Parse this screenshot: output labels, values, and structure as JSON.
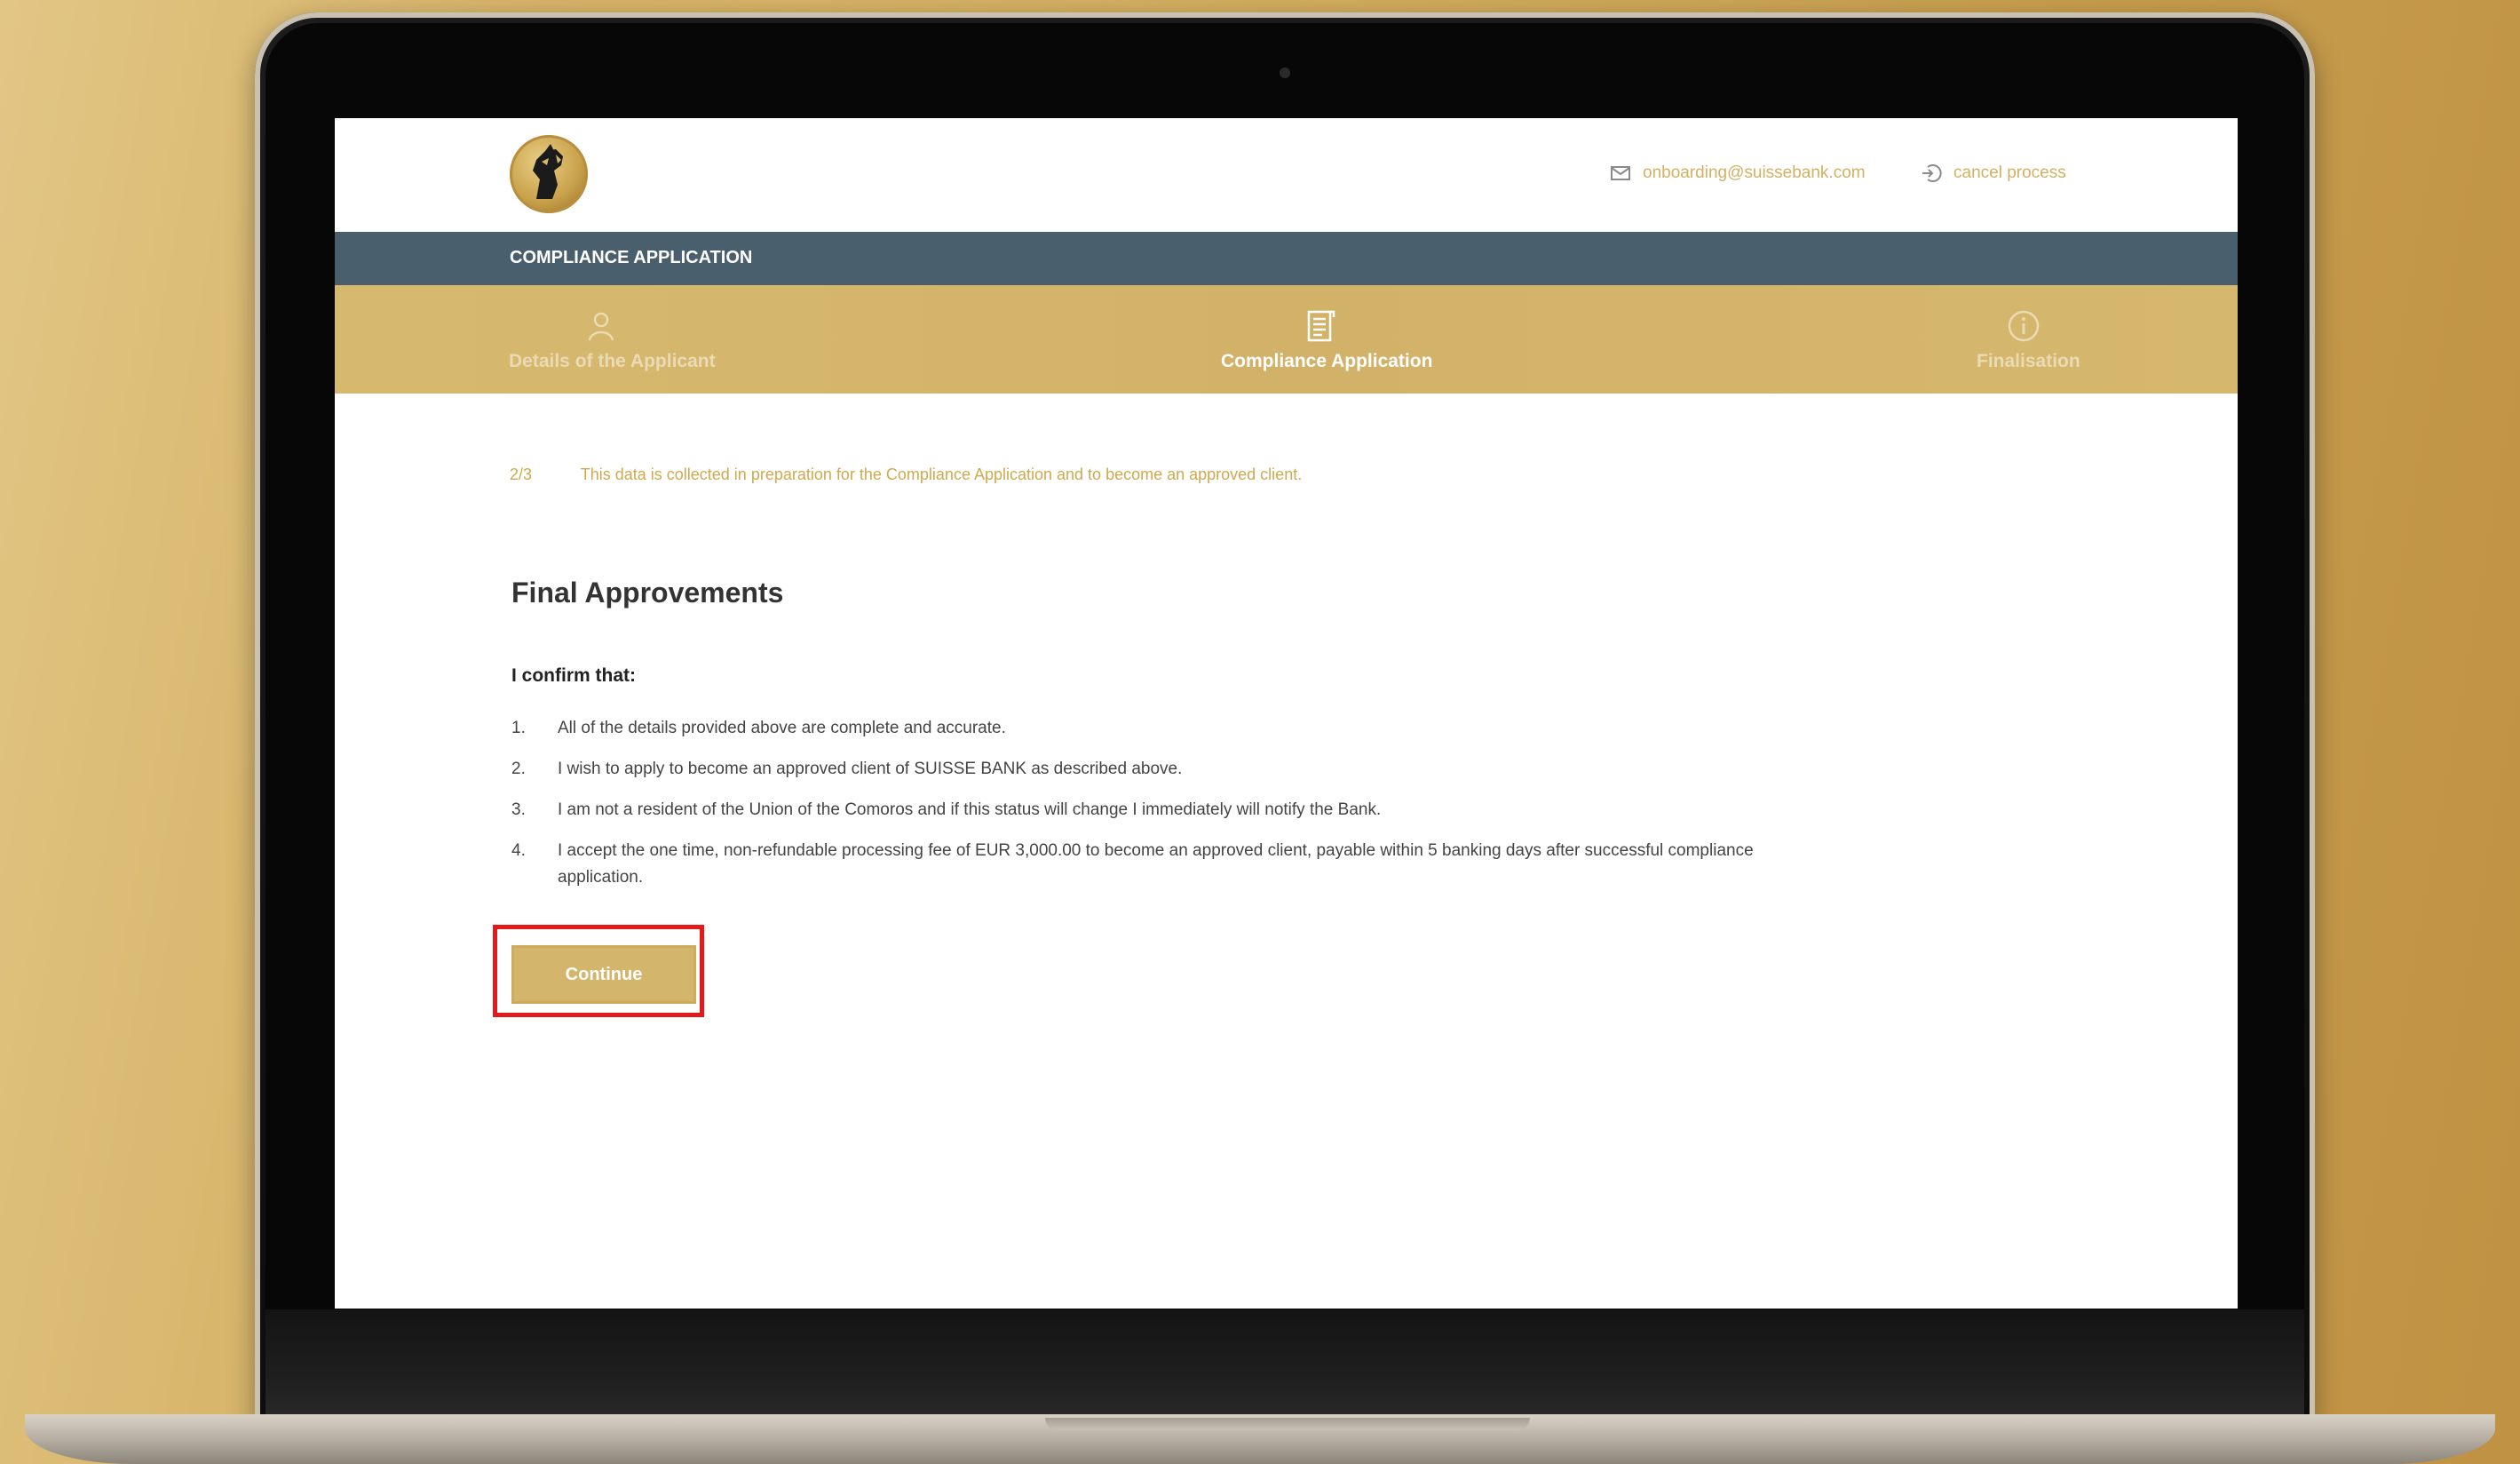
{
  "header": {
    "logo": "horse-head-logo",
    "email": "onboarding@suissebank.com",
    "email_icon": "mail-icon",
    "cancel_label": "cancel process",
    "cancel_icon": "logout-icon"
  },
  "title_bar": {
    "label": "COMPLIANCE APPLICATION"
  },
  "steps": [
    {
      "label": "Details of the Applicant",
      "icon": "user-icon",
      "active": false
    },
    {
      "label": "Compliance Application",
      "icon": "document-icon",
      "active": true
    },
    {
      "label": "Finalisation",
      "icon": "info-icon",
      "active": false
    }
  ],
  "info": {
    "step": "2/3",
    "text": "This data is collected in preparation for the Compliance Application and to become an approved client."
  },
  "section": {
    "title": "Final Approvements",
    "confirm": "I confirm that:",
    "items": [
      {
        "num": "1.",
        "text": "All of the details provided above are complete and accurate."
      },
      {
        "num": "2.",
        "text": "I wish to apply to become an approved client of SUISSE BANK as described above."
      },
      {
        "num": "3.",
        "text": "I am not a resident of the Union of the Comoros and if this status will change I immediately will notify the Bank."
      },
      {
        "num": "4.",
        "text": "I accept the one time, non-refundable processing fee of EUR 3,000.00 to become an approved client, payable within 5 banking days after successful compliance application."
      }
    ]
  },
  "actions": {
    "continue_label": "Continue"
  },
  "colors": {
    "gold": "#d3b56b",
    "title_bar": "#4a5f6d",
    "highlight": "#e41a1a"
  }
}
